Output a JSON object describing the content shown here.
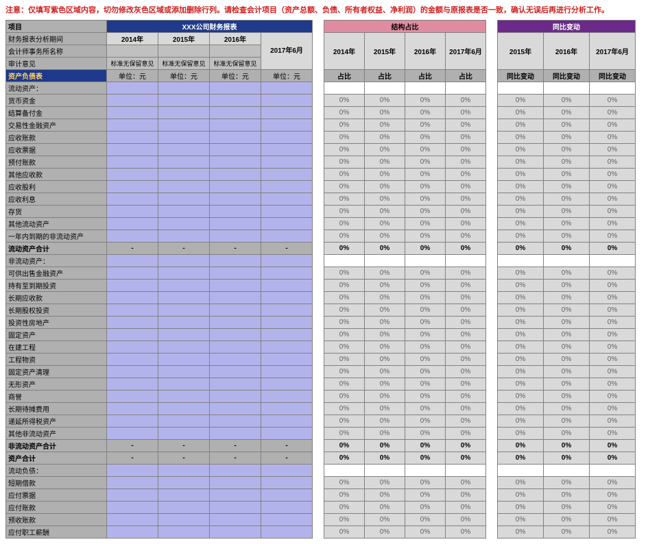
{
  "warning": "注意：仅填写紫色区域内容，切勿修改灰色区域或添加删除行列。请检查会计项目（资产总额、负债、所有者权益、净利润）的金额与原报表是否一致，确认无误后再进行分析工作。",
  "titles": {
    "main": "XXX公司财务报表",
    "ratio": "结构占比",
    "change": "同比变动"
  },
  "labels": {
    "item": "项目",
    "period": "财务报表分析期间",
    "firm": "会计师事务所名称",
    "opinion": "审计意见",
    "unit": "单位：元",
    "opinion_val": "标准无保留意见",
    "ratio_lbl": "占比",
    "change_lbl": "同比变动"
  },
  "years": [
    "2014年",
    "2015年",
    "2016年",
    "2017年6月"
  ],
  "change_years": [
    "2015年",
    "2016年",
    "2017年6月"
  ],
  "section": "资产负债表",
  "rows": [
    {
      "t": "流动资产：",
      "noratio": true
    },
    {
      "t": "货币资金"
    },
    {
      "t": "结算备付金"
    },
    {
      "t": "交易性金融资产"
    },
    {
      "t": "应收账款"
    },
    {
      "t": "应收票据"
    },
    {
      "t": "预付账款"
    },
    {
      "t": "其他应收款"
    },
    {
      "t": "应收股利"
    },
    {
      "t": "应收利息"
    },
    {
      "t": "存货"
    },
    {
      "t": "其他流动资产"
    },
    {
      "t": "一年内到期的非流动资产"
    },
    {
      "t": "流动资产合计",
      "bold": true,
      "dash": true
    },
    {
      "t": "非流动资产：",
      "noratio": true
    },
    {
      "t": "可供出售金融资产"
    },
    {
      "t": "持有至到期投资"
    },
    {
      "t": "长期应收款"
    },
    {
      "t": "长期股权投资"
    },
    {
      "t": "投资性房地产"
    },
    {
      "t": "固定资产"
    },
    {
      "t": "在建工程"
    },
    {
      "t": "工程物资"
    },
    {
      "t": "固定资产清理"
    },
    {
      "t": "无形资产"
    },
    {
      "t": "商誉"
    },
    {
      "t": "长期待摊费用"
    },
    {
      "t": "递延所得税资产"
    },
    {
      "t": "其他非流动资产"
    },
    {
      "t": "非流动资产合计",
      "bold": true,
      "dash": true
    },
    {
      "t": "资产合计",
      "bold": true,
      "dash": true
    },
    {
      "t": "流动负债：",
      "noratio": true
    },
    {
      "t": "短期借款"
    },
    {
      "t": "应付票据"
    },
    {
      "t": "应付账款"
    },
    {
      "t": "预收账款"
    },
    {
      "t": "应付职工薪酬"
    }
  ],
  "pct": "0%",
  "dash": "-"
}
